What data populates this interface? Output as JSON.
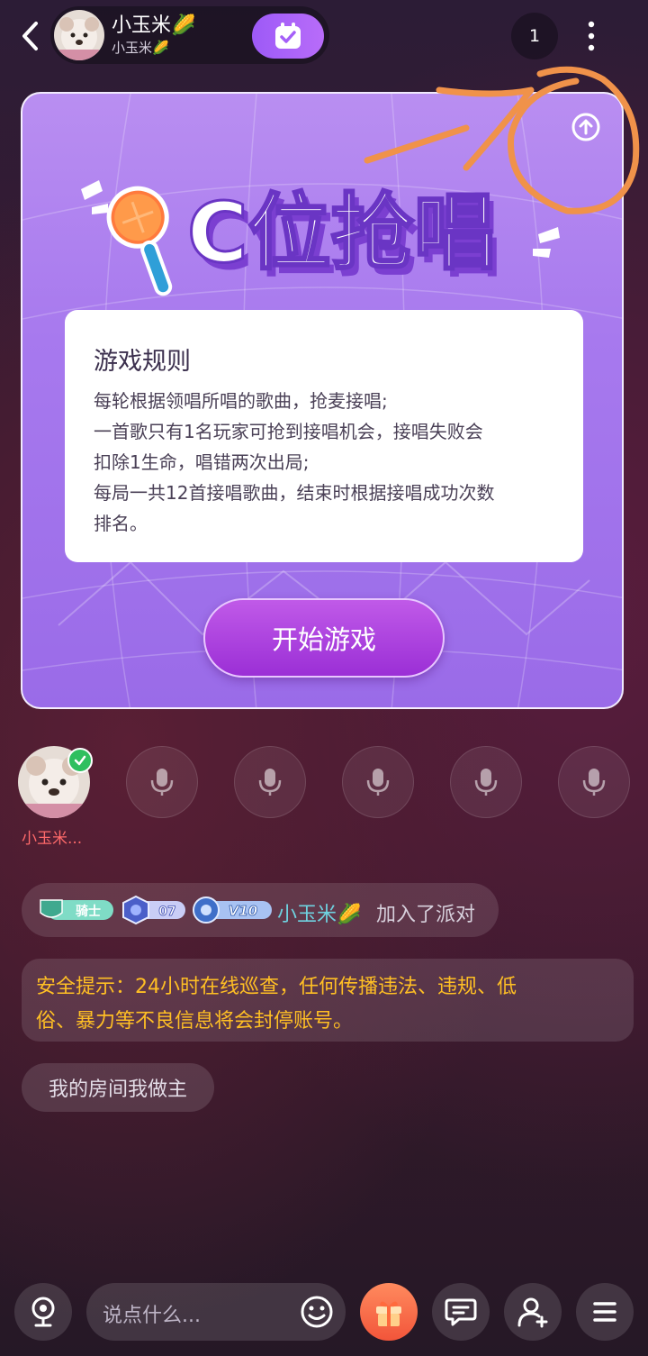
{
  "header": {
    "room_title": "小玉米🌽",
    "room_subtitle": "小玉米🌽",
    "online_count": "1"
  },
  "game": {
    "title": "C位抢唱",
    "rules_title": "游戏规则",
    "rules": [
      "每轮根据领唱所唱的歌曲，抢麦接唱;",
      "一首歌只有1名玩家可抢到接唱机会，接唱失败会",
      "扣除1生命，唱错两次出局;",
      "每局一共12首接唱歌曲，结束时根据接唱成功次数",
      "排名。"
    ],
    "start_button": "开始游戏"
  },
  "seats": {
    "host_name": "小玉米..."
  },
  "chat": {
    "badges": {
      "knight": "骑士",
      "level": "07",
      "vip": "V10"
    },
    "join_name": "小玉米🌽",
    "join_text": "加入了派对",
    "safety_lines": [
      "安全提示：24小时在线巡查，任何传播违法、违规、低",
      "俗、暴力等不良信息将会封停账号。"
    ],
    "welcome": "我的房间我做主"
  },
  "bottom_bar": {
    "input_placeholder": "说点什么..."
  },
  "colors": {
    "accent_purple": "#9d5af7",
    "card_purple": "#a779ee",
    "warning_yellow": "#ffbf24",
    "host_name_red": "#ff6a6a",
    "name_cyan": "#6fd2e0",
    "annotation_orange": "#f0924a"
  }
}
